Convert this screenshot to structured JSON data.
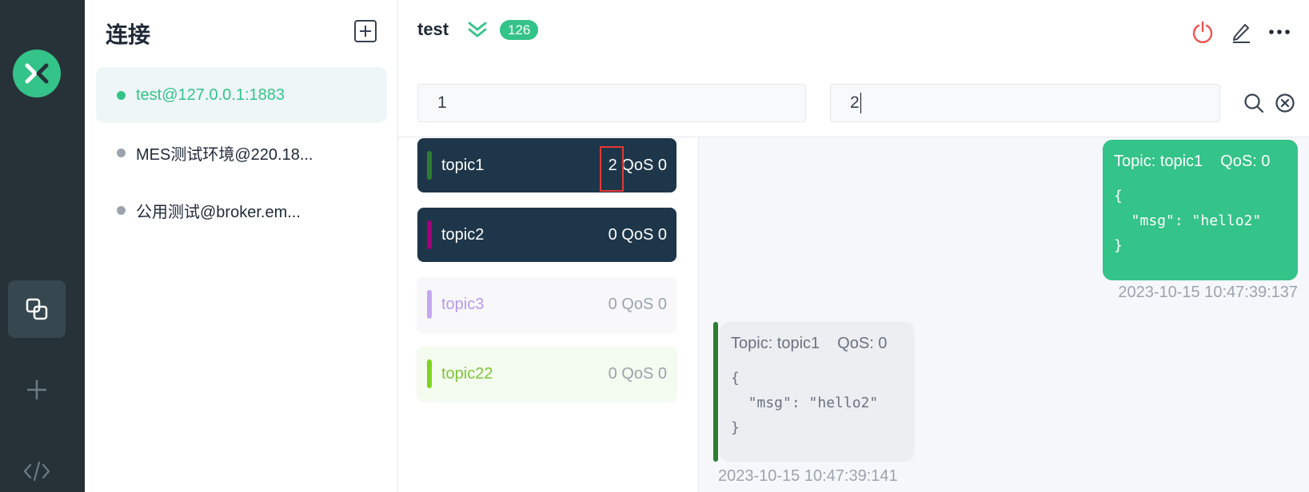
{
  "colors": {
    "accent": "#34c388",
    "rail": "#263238",
    "topic_dark": "#1e364a",
    "danger": "#e53935"
  },
  "rail": {
    "items": [
      {
        "icon": "mqttx-logo"
      },
      {
        "icon": "connections-icon"
      },
      {
        "icon": "plus-icon"
      },
      {
        "icon": "code-icon"
      }
    ]
  },
  "connections": {
    "title": "连接",
    "items": [
      {
        "label": "test@127.0.0.1:1883",
        "status": "connected"
      },
      {
        "label": "MES测试环境@220.18...",
        "status": "disconnected"
      },
      {
        "label": "公用测试@broker.em...",
        "status": "disconnected"
      }
    ]
  },
  "header": {
    "name": "test",
    "count": "126"
  },
  "filters": {
    "topic": "1",
    "payload": "2"
  },
  "topics": [
    {
      "name": "topic1",
      "count": "2",
      "qos": "QoS 0",
      "color": "#2e7d32"
    },
    {
      "name": "topic2",
      "count": "0",
      "qos": "QoS 0",
      "color": "#a3007d"
    },
    {
      "name": "topic3",
      "count": "0",
      "qos": "QoS 0",
      "color": "#c4a7f0"
    },
    {
      "name": "topic22",
      "count": "0",
      "qos": "QoS 0",
      "color": "#7ed321"
    }
  ],
  "messages": [
    {
      "direction": "out",
      "topic": "Topic: topic1",
      "qos": "QoS: 0",
      "payload": "{\n  \"msg\": \"hello2\"\n}",
      "time": "2023-10-15 10:47:39:137"
    },
    {
      "direction": "in",
      "topic": "Topic: topic1",
      "qos": "QoS: 0",
      "payload": "{\n  \"msg\": \"hello2\"\n}",
      "time": "2023-10-15 10:47:39:141"
    }
  ]
}
